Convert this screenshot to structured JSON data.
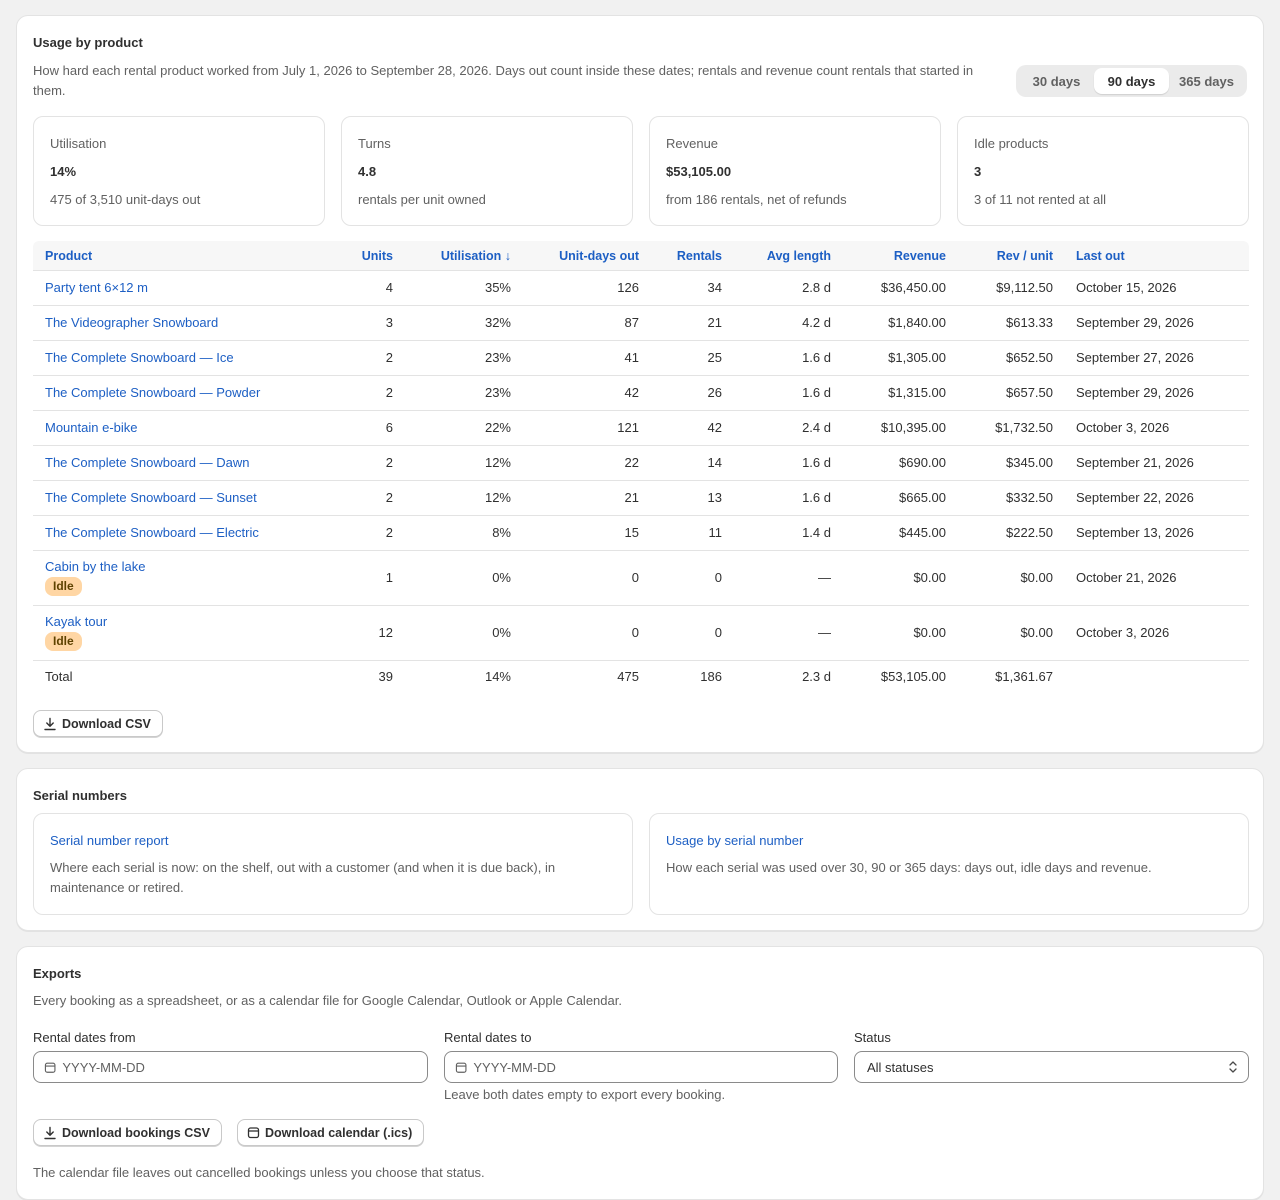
{
  "usage": {
    "title": "Usage by product",
    "description": "How hard each rental product worked from July 1, 2026 to September 28, 2026. Days out count inside these dates; rentals and revenue count rentals that started in them.",
    "ranges": [
      {
        "label": "30 days",
        "active": false
      },
      {
        "label": "90 days",
        "active": true
      },
      {
        "label": "365 days",
        "active": false
      }
    ],
    "stats": [
      {
        "label": "Utilisation",
        "value": "14%",
        "sub": "475 of 3,510 unit-days out"
      },
      {
        "label": "Turns",
        "value": "4.8",
        "sub": "rentals per unit owned"
      },
      {
        "label": "Revenue",
        "value": "$53,105.00",
        "sub": "from 186 rentals, net of refunds"
      },
      {
        "label": "Idle products",
        "value": "3",
        "sub": "3 of 11 not rented at all"
      }
    ],
    "columns": {
      "product": "Product",
      "units": "Units",
      "utilisation": "Utilisation ↓",
      "unit_days": "Unit-days out",
      "rentals": "Rentals",
      "avg_length": "Avg length",
      "revenue": "Revenue",
      "rev_unit": "Rev / unit",
      "last_out": "Last out"
    },
    "rows": [
      {
        "product": "Party tent 6×12 m",
        "units": "4",
        "utilisation": "35%",
        "unit_days": "126",
        "rentals": "34",
        "avg_length": "2.8 d",
        "revenue": "$36,450.00",
        "rev_unit": "$9,112.50",
        "last_out": "October 15, 2026",
        "badge": ""
      },
      {
        "product": "The Videographer Snowboard",
        "units": "3",
        "utilisation": "32%",
        "unit_days": "87",
        "rentals": "21",
        "avg_length": "4.2 d",
        "revenue": "$1,840.00",
        "rev_unit": "$613.33",
        "last_out": "September 29, 2026",
        "badge": ""
      },
      {
        "product": "The Complete Snowboard — Ice",
        "units": "2",
        "utilisation": "23%",
        "unit_days": "41",
        "rentals": "25",
        "avg_length": "1.6 d",
        "revenue": "$1,305.00",
        "rev_unit": "$652.50",
        "last_out": "September 27, 2026",
        "badge": ""
      },
      {
        "product": "The Complete Snowboard — Powder",
        "units": "2",
        "utilisation": "23%",
        "unit_days": "42",
        "rentals": "26",
        "avg_length": "1.6 d",
        "revenue": "$1,315.00",
        "rev_unit": "$657.50",
        "last_out": "September 29, 2026",
        "badge": ""
      },
      {
        "product": "Mountain e-bike",
        "units": "6",
        "utilisation": "22%",
        "unit_days": "121",
        "rentals": "42",
        "avg_length": "2.4 d",
        "revenue": "$10,395.00",
        "rev_unit": "$1,732.50",
        "last_out": "October 3, 2026",
        "badge": ""
      },
      {
        "product": "The Complete Snowboard — Dawn",
        "units": "2",
        "utilisation": "12%",
        "unit_days": "22",
        "rentals": "14",
        "avg_length": "1.6 d",
        "revenue": "$690.00",
        "rev_unit": "$345.00",
        "last_out": "September 21, 2026",
        "badge": ""
      },
      {
        "product": "The Complete Snowboard — Sunset",
        "units": "2",
        "utilisation": "12%",
        "unit_days": "21",
        "rentals": "13",
        "avg_length": "1.6 d",
        "revenue": "$665.00",
        "rev_unit": "$332.50",
        "last_out": "September 22, 2026",
        "badge": ""
      },
      {
        "product": "The Complete Snowboard — Electric",
        "units": "2",
        "utilisation": "8%",
        "unit_days": "15",
        "rentals": "11",
        "avg_length": "1.4 d",
        "revenue": "$445.00",
        "rev_unit": "$222.50",
        "last_out": "September 13, 2026",
        "badge": ""
      },
      {
        "product": "Cabin by the lake",
        "units": "1",
        "utilisation": "0%",
        "unit_days": "0",
        "rentals": "0",
        "avg_length": "—",
        "revenue": "$0.00",
        "rev_unit": "$0.00",
        "last_out": "October 21, 2026",
        "badge": "Idle"
      },
      {
        "product": "Kayak tour",
        "units": "12",
        "utilisation": "0%",
        "unit_days": "0",
        "rentals": "0",
        "avg_length": "—",
        "revenue": "$0.00",
        "rev_unit": "$0.00",
        "last_out": "October 3, 2026",
        "badge": "Idle"
      }
    ],
    "total": {
      "product": "Total",
      "units": "39",
      "utilisation": "14%",
      "unit_days": "475",
      "rentals": "186",
      "avg_length": "2.3 d",
      "revenue": "$53,105.00",
      "rev_unit": "$1,361.67",
      "last_out": ""
    },
    "download_csv": "Download CSV"
  },
  "serial": {
    "title": "Serial numbers",
    "cards": [
      {
        "link": "Serial number report",
        "text": "Where each serial is now: on the shelf, out with a customer (and when it is due back), in maintenance or retired."
      },
      {
        "link": "Usage by serial number",
        "text": "How each serial was used over 30, 90 or 365 days: days out, idle days and revenue."
      }
    ]
  },
  "exports": {
    "title": "Exports",
    "description": "Every booking as a spreadsheet, or as a calendar file for Google Calendar, Outlook or Apple Calendar.",
    "from_label": "Rental dates from",
    "from_placeholder": "YYYY-MM-DD",
    "to_label": "Rental dates to",
    "to_placeholder": "YYYY-MM-DD",
    "status_label": "Status",
    "status_value": "All statuses",
    "help": "Leave both dates empty to export every booking.",
    "csv_button": "Download bookings CSV",
    "ics_button": "Download calendar (.ics)",
    "footnote": "The calendar file leaves out cancelled bookings unless you choose that status."
  },
  "colors": {
    "link": "#1d5fc4",
    "badge_idle": "#ffd6a4"
  }
}
